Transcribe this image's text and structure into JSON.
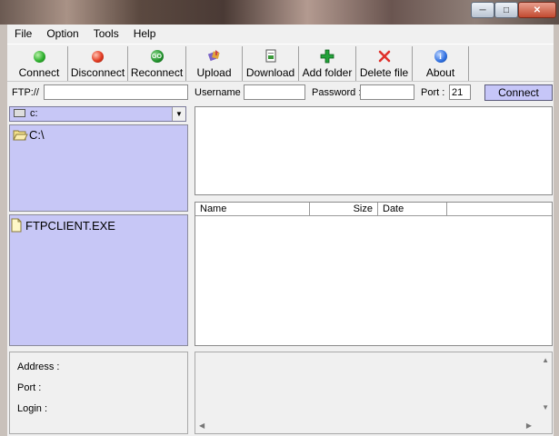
{
  "menu": [
    "File",
    "Option",
    "Tools",
    "Help"
  ],
  "toolbar": {
    "connect": "Connect",
    "disconnect": "Disconnect",
    "reconnect": "Reconnect",
    "upload": "Upload",
    "download": "Download",
    "add_folder": "Add folder",
    "delete_file": "Delete file",
    "about": "About"
  },
  "connection": {
    "ftp_label": "FTP://",
    "ftp_value": "",
    "username_label": "Username :",
    "username_value": "",
    "password_label": "Password :",
    "password_value": "",
    "port_label": "Port :",
    "port_value": "21",
    "connect_button": "Connect"
  },
  "local": {
    "drive": "c:",
    "folder": "C:\\",
    "files": [
      "FTPCLIENT.EXE"
    ]
  },
  "remote_list": {
    "columns": [
      "Name",
      "Size",
      "Date"
    ]
  },
  "info": {
    "address_label": "Address :",
    "port_label": "Port :",
    "login_label": "Login :"
  },
  "colors": {
    "pane_bg": "#c7c7f6",
    "connect_green": "#2fb12f",
    "disconnect_red": "#e23b22",
    "reconnect_green": "#1f8f2a",
    "add_folder_green": "#23a23a",
    "delete_red": "#e0302a",
    "about_blue": "#2d6ee0"
  }
}
